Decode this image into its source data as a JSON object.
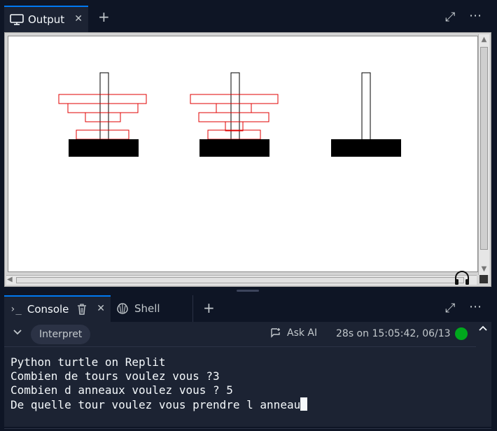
{
  "output_pane": {
    "tab_label": "Output",
    "tab_icon": "monitor-icon",
    "close_glyph": "✕",
    "add_glyph": "+",
    "expand_glyph": "⤢",
    "more_glyph": "⋯"
  },
  "turtle_canvas": {
    "towers": [
      {
        "rings": 4
      },
      {
        "rings": 5
      },
      {
        "rings": 0
      }
    ],
    "ring_color": "#e00000",
    "peg_color": "#000000"
  },
  "console_pane": {
    "tabs": [
      {
        "label": "Console",
        "icon": "terminal-prompt-icon",
        "active": true
      },
      {
        "label": "Shell",
        "icon": "shell-icon",
        "active": false
      }
    ],
    "prompt_glyph": "›_",
    "close_glyph": "✕",
    "add_glyph": "+",
    "expand_glyph": "⤢",
    "more_glyph": "⋯",
    "toolbar": {
      "collapse_glyph": "⌄",
      "interpret_label": "Interpret",
      "ask_ai_label": "Ask AI",
      "run_status": "28s on 15:05:42, 06/13",
      "status_color": "#00a81d"
    },
    "lines": [
      "Python turtle on Replit",
      "Combien de tours voulez vous ?3",
      "Combien d anneaux voulez vous ? 5",
      "De quelle tour voulez vous prendre l anneau"
    ],
    "scroll_up_glyph": "⌃"
  }
}
